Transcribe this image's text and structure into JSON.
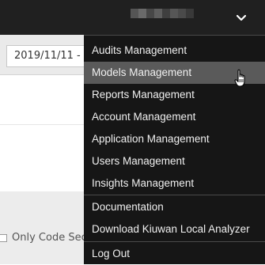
{
  "header": {
    "user_menu_icon": "chevron-down-icon",
    "user_blur_colors": [
      "#555555",
      "#6a6a6a",
      "#474747",
      "#5e5e5e",
      "#3f3f3f",
      "#565656",
      "#4a4a4a",
      "#393939"
    ]
  },
  "toolbar": {
    "date_range": "2019/11/11 - 2"
  },
  "filters": {
    "only_code_label": "Only Code Sec"
  },
  "dropdown_menu": {
    "hovered_item": "Models Management",
    "items": [
      {
        "label": "Audits Management"
      },
      {
        "label": "Models Management"
      },
      {
        "label": "Reports Management"
      },
      {
        "label": "Account Management"
      },
      {
        "label": "Application Management"
      },
      {
        "label": "Users Management"
      },
      {
        "label": "Insights Management"
      },
      {
        "label": "Documentation"
      },
      {
        "label": "Download Kiuwan Local Analyzer"
      },
      {
        "label": "Log Out"
      }
    ]
  },
  "colors": {
    "menu_bg": "#161616",
    "menu_hover": "#5a5a5a",
    "header_bg": "#202020",
    "toolbar_bg": "#eaeaea"
  }
}
